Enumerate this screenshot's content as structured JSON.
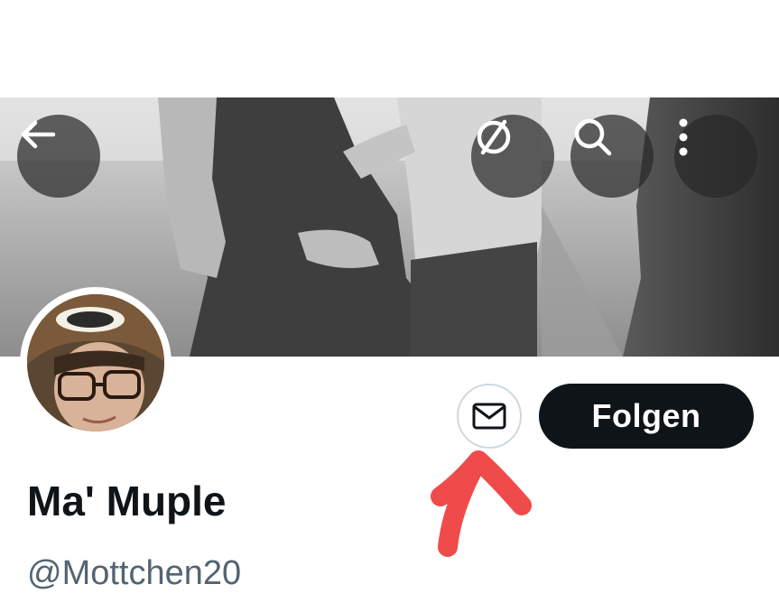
{
  "header": {
    "back_icon": "arrow-left-icon",
    "actions": [
      {
        "icon": "hidden-circle-slash-icon"
      },
      {
        "icon": "search-icon"
      },
      {
        "icon": "more-vertical-icon"
      }
    ]
  },
  "profile": {
    "display_name": "Ma' Muple",
    "handle": "@Mottchen20",
    "dm_icon": "mail-icon",
    "follow_label": "Folgen"
  },
  "colors": {
    "follow_bg": "#0f1419",
    "text_primary": "#0f1419",
    "text_secondary": "#536471",
    "annotation_arrow": "#f04b4b"
  }
}
